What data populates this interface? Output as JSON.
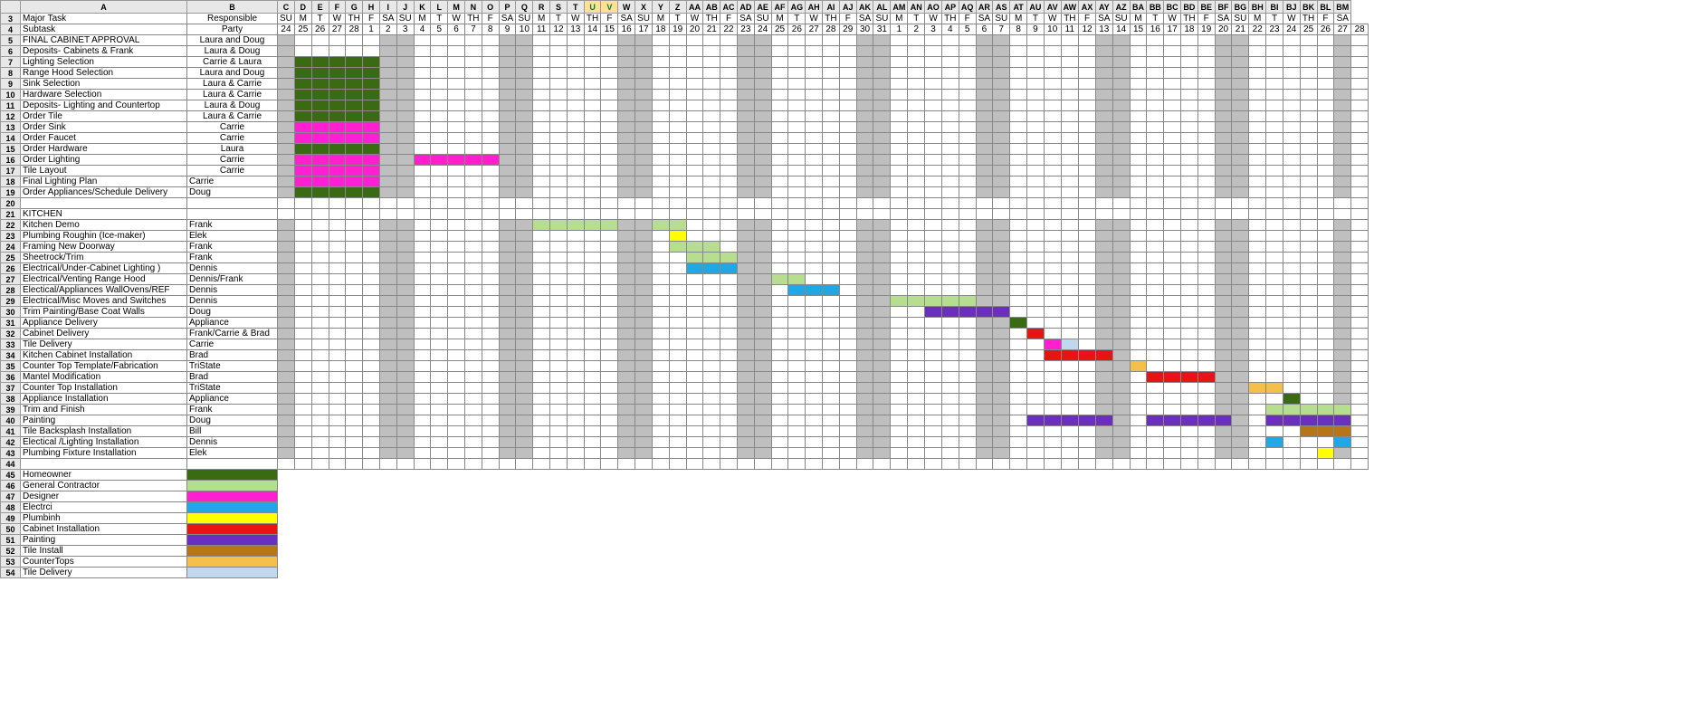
{
  "columns": [
    "A",
    "B",
    "C",
    "D",
    "E",
    "F",
    "G",
    "H",
    "I",
    "J",
    "K",
    "L",
    "M",
    "N",
    "O",
    "P",
    "Q",
    "R",
    "S",
    "T",
    "U",
    "V",
    "W",
    "X",
    "Y",
    "Z",
    "AA",
    "AB",
    "AC",
    "AD",
    "AE",
    "AF",
    "AG",
    "AH",
    "AI",
    "AJ",
    "AK",
    "AL",
    "AM",
    "AN",
    "AO",
    "AP",
    "AQ",
    "AR",
    "AS",
    "AT",
    "AU",
    "AV",
    "AW",
    "AX",
    "AY",
    "AZ",
    "BA",
    "BB",
    "BC",
    "BD",
    "BE",
    "BF",
    "BG",
    "BH",
    "BI",
    "BJ",
    "BK",
    "BL",
    "BM"
  ],
  "selected_cols": [
    "U",
    "V"
  ],
  "weekdays": [
    "SU",
    "M",
    "T",
    "W",
    "TH",
    "F",
    "SA",
    "SU",
    "M",
    "T",
    "W",
    "TH",
    "F",
    "SA",
    "SU",
    "M",
    "T",
    "W",
    "TH",
    "F",
    "SA",
    "SU",
    "M",
    "T",
    "W",
    "TH",
    "F",
    "SA",
    "SU",
    "M",
    "T",
    "W",
    "TH",
    "F",
    "SA",
    "SU",
    "M",
    "T",
    "W",
    "TH",
    "F",
    "SA",
    "SU",
    "M",
    "T",
    "W",
    "TH",
    "F",
    "SA",
    "SU",
    "M",
    "T",
    "W",
    "TH",
    "F",
    "SA",
    "SU",
    "M",
    "T",
    "W",
    "TH",
    "F",
    "SA"
  ],
  "dates": [
    "24",
    "25",
    "26",
    "27",
    "28",
    "1",
    "2",
    "3",
    "4",
    "5",
    "6",
    "7",
    "8",
    "9",
    "10",
    "11",
    "12",
    "13",
    "14",
    "15",
    "16",
    "17",
    "18",
    "19",
    "20",
    "21",
    "22",
    "23",
    "24",
    "25",
    "26",
    "27",
    "28",
    "29",
    "30",
    "31",
    "1",
    "2",
    "3",
    "4",
    "5",
    "6",
    "7",
    "8",
    "9",
    "10",
    "11",
    "12",
    "13",
    "14",
    "15",
    "16",
    "17",
    "18",
    "19",
    "20",
    "21",
    "22",
    "23",
    "24",
    "25",
    "26",
    "27",
    "28"
  ],
  "headers": {
    "major": "Major Task",
    "resp": "Responsible",
    "sub": "Subtask",
    "party": "Party"
  },
  "tasks": [
    {
      "r": 5,
      "a": "FINAL CABINET APPROVAL",
      "b": "Laura and Doug",
      "bc": "ac",
      "bars": []
    },
    {
      "r": 6,
      "a": "Deposits- Cabinets & Frank",
      "b": "Laura & Doug",
      "bc": "ac",
      "bars": []
    },
    {
      "r": 7,
      "a": "Lighting Selection",
      "b": "Carrie & Laura",
      "bc": "ac",
      "bars": [
        [
          1,
          5,
          "ho"
        ]
      ]
    },
    {
      "r": 8,
      "a": "Range Hood Selection",
      "b": "Laura and Doug",
      "bc": "ac",
      "bars": [
        [
          1,
          5,
          "ho"
        ]
      ]
    },
    {
      "r": 9,
      "a": "Sink Selection",
      "b": "Laura  & Carrie",
      "bc": "ac",
      "bars": [
        [
          1,
          5,
          "ho"
        ]
      ]
    },
    {
      "r": 10,
      "a": "Hardware Selection",
      "b": "Laura  & Carrie",
      "bc": "ac",
      "bars": [
        [
          1,
          5,
          "ho"
        ]
      ]
    },
    {
      "r": 11,
      "a": "Deposits- Lighting and Countertop",
      "b": "Laura & Doug",
      "bc": "ac",
      "bars": [
        [
          1,
          5,
          "ho"
        ]
      ]
    },
    {
      "r": 12,
      "a": "Order Tile",
      "b": "Laura & Carrie",
      "bc": "ac",
      "bars": [
        [
          1,
          5,
          "ho"
        ]
      ]
    },
    {
      "r": 13,
      "a": "Order Sink",
      "b": "Carrie",
      "bc": "ac",
      "bars": [
        [
          1,
          5,
          "dg"
        ]
      ]
    },
    {
      "r": 14,
      "a": "Order Faucet",
      "b": "Carrie",
      "bc": "ac",
      "bars": [
        [
          1,
          5,
          "dg"
        ]
      ]
    },
    {
      "r": 15,
      "a": "Order Hardware",
      "b": "Laura",
      "bc": "ac",
      "bars": [
        [
          1,
          5,
          "ho"
        ]
      ]
    },
    {
      "r": 16,
      "a": "Order Lighting",
      "b": "Carrie",
      "bc": "ac",
      "bars": [
        [
          1,
          5,
          "dg"
        ],
        [
          8,
          12,
          "dg"
        ]
      ]
    },
    {
      "r": 17,
      "a": "Tile Layout",
      "b": "Carrie",
      "bc": "ac",
      "bars": [
        [
          1,
          5,
          "dg"
        ]
      ]
    },
    {
      "r": 18,
      "a": "Final Lighting Plan",
      "b": "Carrie",
      "bc": "al",
      "bars": [
        [
          1,
          5,
          "dg"
        ]
      ]
    },
    {
      "r": 19,
      "a": "Order Appliances/Schedule Delivery",
      "b": "Doug",
      "bc": "al",
      "bars": [
        [
          1,
          5,
          "ho"
        ]
      ]
    },
    {
      "r": 20,
      "a": "",
      "b": "",
      "bars": []
    },
    {
      "r": 21,
      "a": "KITCHEN",
      "b": "",
      "bars": []
    },
    {
      "r": 22,
      "a": "Kitchen Demo",
      "b": "Frank",
      "bars": [
        [
          15,
          19,
          "gc"
        ],
        [
          22,
          23,
          "gc"
        ]
      ]
    },
    {
      "r": 23,
      "a": "Plumbing Roughin (Ice-maker)",
      "b": "Elek",
      "bars": [
        [
          23,
          23,
          "pl"
        ]
      ]
    },
    {
      "r": 24,
      "a": "Framing New Doorway",
      "b": "Frank",
      "bars": [
        [
          23,
          25,
          "gc"
        ]
      ]
    },
    {
      "r": 25,
      "a": "Sheetrock/Trim",
      "b": "Frank",
      "bars": [
        [
          24,
          26,
          "gc"
        ]
      ]
    },
    {
      "r": 26,
      "a": "Electrical/Under-Cabinet Lighting )",
      "b": "Dennis",
      "bars": [
        [
          24,
          26,
          "el"
        ]
      ]
    },
    {
      "r": 27,
      "a": "Electrical/Venting Range Hood",
      "b": "Dennis/Frank",
      "bars": [
        [
          29,
          30,
          "gc"
        ]
      ]
    },
    {
      "r": 28,
      "a": "Electical/Appliances WallOvens/REF",
      "b": "Dennis",
      "bars": [
        [
          30,
          32,
          "el"
        ]
      ]
    },
    {
      "r": 29,
      "a": "Electrical/Misc Moves and Switches",
      "b": "Dennis",
      "bars": [
        [
          36,
          40,
          "gc"
        ]
      ]
    },
    {
      "r": 30,
      "a": "Trim Painting/Base Coat Walls",
      "b": "Doug",
      "bars": [
        [
          38,
          42,
          "pt"
        ]
      ]
    },
    {
      "r": 31,
      "a": "Appliance Delivery",
      "b": "Appliance",
      "bars": [
        [
          43,
          43,
          "ho"
        ]
      ]
    },
    {
      "r": 32,
      "a": "Cabinet Delivery",
      "b": "Frank/Carrie & Brad",
      "bars": [
        [
          44,
          44,
          "ci"
        ]
      ]
    },
    {
      "r": 33,
      "a": "Tile Delivery",
      "b": "Carrie",
      "bars": [
        [
          45,
          45,
          "dg"
        ],
        [
          46,
          46,
          "td"
        ]
      ]
    },
    {
      "r": 34,
      "a": "Kitchen Cabinet Installation",
      "b": "Brad",
      "bars": [
        [
          45,
          48,
          "ci"
        ]
      ]
    },
    {
      "r": 35,
      "a": "Counter Top Template/Fabrication",
      "b": "TriState",
      "bars": [
        [
          50,
          50,
          "ct"
        ]
      ]
    },
    {
      "r": 36,
      "a": "Mantel Modification",
      "b": "Brad",
      "bars": [
        [
          51,
          54,
          "ci"
        ]
      ]
    },
    {
      "r": 37,
      "a": "Counter Top Installation",
      "b": "TriState",
      "bars": [
        [
          57,
          58,
          "ct"
        ]
      ]
    },
    {
      "r": 38,
      "a": "Appliance Installation",
      "b": "Appliance",
      "bars": [
        [
          59,
          59,
          "ho"
        ]
      ]
    },
    {
      "r": 39,
      "a": "Trim and Finish",
      "b": "Frank",
      "bars": [
        [
          58,
          62,
          "gc"
        ]
      ]
    },
    {
      "r": 40,
      "a": "Painting",
      "b": "Doug",
      "bars": [
        [
          44,
          48,
          "pt"
        ],
        [
          51,
          55,
          "pt"
        ],
        [
          58,
          62,
          "pt"
        ]
      ]
    },
    {
      "r": 41,
      "a": "Tile Backsplash Installation",
      "b": "Bill",
      "bars": [
        [
          60,
          62,
          "ti"
        ]
      ]
    },
    {
      "r": 42,
      "a": "Electical /Lighting Installation",
      "b": "Dennis",
      "bars": [
        [
          58,
          58,
          "el"
        ],
        [
          62,
          62,
          "el"
        ]
      ]
    },
    {
      "r": 43,
      "a": "Plumbing Fixture Installation",
      "b": "Elek",
      "bars": [
        [
          61,
          61,
          "pl"
        ]
      ]
    },
    {
      "r": 44,
      "a": "",
      "b": "",
      "bars": []
    }
  ],
  "legend": [
    {
      "r": 45,
      "label": "Homeowner",
      "color": "ho"
    },
    {
      "r": 46,
      "label": "General Contractor",
      "color": "gc"
    },
    {
      "r": 47,
      "label": "Designer",
      "color": "dg"
    },
    {
      "r": 48,
      "label": "Electrci",
      "color": "el"
    },
    {
      "r": 49,
      "label": "Plumbinh",
      "color": "pl"
    },
    {
      "r": 50,
      "label": "Cabinet Installation",
      "color": "ci"
    },
    {
      "r": 51,
      "label": "Painting",
      "color": "pt"
    },
    {
      "r": 52,
      "label": "Tile Install",
      "color": "ti"
    },
    {
      "r": 53,
      "label": "CounterTops",
      "color": "ct"
    },
    {
      "r": 54,
      "label": "Tile Delivery",
      "color": "td"
    }
  ],
  "colors": {
    "ho": "#3a6b12",
    "gc": "#b7dd8e",
    "dg": "#ff1fd1",
    "el": "#1fa8e8",
    "pl": "#ffff00",
    "ci": "#e61414",
    "pt": "#6b2fbf",
    "ti": "#b87418",
    "ct": "#f5c04a",
    "td": "#c1d7ee",
    "wk": "#bfbfbf"
  },
  "chart_data": {
    "type": "gantt",
    "title": "Kitchen Renovation Schedule (spreadsheet Gantt chart)",
    "x_axis": "calendar days (day number row 4, weekday row 3)",
    "series_meaning": "bar start/end are 0-based indices into the dates[] array above; color keys map to legend categories",
    "weekend_col_indices": [
      0,
      6,
      7,
      13,
      14,
      20,
      21,
      27,
      28,
      34,
      35,
      41,
      42,
      48,
      49,
      55,
      56,
      62
    ],
    "tasks": [
      {
        "name": "Lighting Selection",
        "party": "Carrie & Laura",
        "segments": [
          [
            1,
            5,
            "ho"
          ]
        ]
      },
      {
        "name": "Range Hood Selection",
        "party": "Laura and Doug",
        "segments": [
          [
            1,
            5,
            "ho"
          ]
        ]
      },
      {
        "name": "Sink Selection",
        "party": "Laura & Carrie",
        "segments": [
          [
            1,
            5,
            "ho"
          ]
        ]
      },
      {
        "name": "Hardware Selection",
        "party": "Laura & Carrie",
        "segments": [
          [
            1,
            5,
            "ho"
          ]
        ]
      },
      {
        "name": "Deposits- Lighting and Countertop",
        "party": "Laura & Doug",
        "segments": [
          [
            1,
            5,
            "ho"
          ]
        ]
      },
      {
        "name": "Order Tile",
        "party": "Laura & Carrie",
        "segments": [
          [
            1,
            5,
            "ho"
          ]
        ]
      },
      {
        "name": "Order Sink",
        "party": "Carrie",
        "segments": [
          [
            1,
            5,
            "dg"
          ]
        ]
      },
      {
        "name": "Order Faucet",
        "party": "Carrie",
        "segments": [
          [
            1,
            5,
            "dg"
          ]
        ]
      },
      {
        "name": "Order Hardware",
        "party": "Laura",
        "segments": [
          [
            1,
            5,
            "ho"
          ]
        ]
      },
      {
        "name": "Order Lighting",
        "party": "Carrie",
        "segments": [
          [
            1,
            5,
            "dg"
          ],
          [
            8,
            12,
            "dg"
          ]
        ]
      },
      {
        "name": "Tile Layout",
        "party": "Carrie",
        "segments": [
          [
            1,
            5,
            "dg"
          ]
        ]
      },
      {
        "name": "Final Lighting Plan",
        "party": "Carrie",
        "segments": [
          [
            1,
            5,
            "dg"
          ]
        ]
      },
      {
        "name": "Order Appliances/Schedule Delivery",
        "party": "Doug",
        "segments": [
          [
            1,
            5,
            "ho"
          ]
        ]
      },
      {
        "name": "Kitchen Demo",
        "party": "Frank",
        "segments": [
          [
            15,
            19,
            "gc"
          ],
          [
            22,
            23,
            "gc"
          ]
        ]
      },
      {
        "name": "Plumbing Roughin (Ice-maker)",
        "party": "Elek",
        "segments": [
          [
            23,
            23,
            "pl"
          ]
        ]
      },
      {
        "name": "Framing New Doorway",
        "party": "Frank",
        "segments": [
          [
            23,
            25,
            "gc"
          ]
        ]
      },
      {
        "name": "Sheetrock/Trim",
        "party": "Frank",
        "segments": [
          [
            24,
            26,
            "gc"
          ]
        ]
      },
      {
        "name": "Electrical/Under-Cabinet Lighting",
        "party": "Dennis",
        "segments": [
          [
            24,
            26,
            "el"
          ]
        ]
      },
      {
        "name": "Electrical/Venting Range Hood",
        "party": "Dennis/Frank",
        "segments": [
          [
            29,
            30,
            "gc"
          ]
        ]
      },
      {
        "name": "Electical/Appliances WallOvens/REF",
        "party": "Dennis",
        "segments": [
          [
            30,
            32,
            "el"
          ]
        ]
      },
      {
        "name": "Electrical/Misc Moves and Switches",
        "party": "Dennis",
        "segments": [
          [
            36,
            40,
            "gc"
          ]
        ]
      },
      {
        "name": "Trim Painting/Base Coat Walls",
        "party": "Doug",
        "segments": [
          [
            38,
            42,
            "pt"
          ]
        ]
      },
      {
        "name": "Appliance Delivery",
        "party": "Appliance",
        "segments": [
          [
            43,
            43,
            "ho"
          ]
        ]
      },
      {
        "name": "Cabinet Delivery",
        "party": "Frank/Carrie & Brad",
        "segments": [
          [
            44,
            44,
            "ci"
          ]
        ]
      },
      {
        "name": "Tile Delivery",
        "party": "Carrie",
        "segments": [
          [
            45,
            45,
            "dg"
          ],
          [
            46,
            46,
            "td"
          ]
        ]
      },
      {
        "name": "Kitchen Cabinet Installation",
        "party": "Brad",
        "segments": [
          [
            45,
            48,
            "ci"
          ]
        ]
      },
      {
        "name": "Counter Top Template/Fabrication",
        "party": "TriState",
        "segments": [
          [
            50,
            50,
            "ct"
          ]
        ]
      },
      {
        "name": "Mantel Modification",
        "party": "Brad",
        "segments": [
          [
            51,
            54,
            "ci"
          ]
        ]
      },
      {
        "name": "Counter Top Installation",
        "party": "TriState",
        "segments": [
          [
            57,
            58,
            "ct"
          ]
        ]
      },
      {
        "name": "Appliance Installation",
        "party": "Appliance",
        "segments": [
          [
            59,
            59,
            "ho"
          ]
        ]
      },
      {
        "name": "Trim and Finish",
        "party": "Frank",
        "segments": [
          [
            58,
            62,
            "gc"
          ]
        ]
      },
      {
        "name": "Painting",
        "party": "Doug",
        "segments": [
          [
            44,
            48,
            "pt"
          ],
          [
            51,
            55,
            "pt"
          ],
          [
            58,
            62,
            "pt"
          ]
        ]
      },
      {
        "name": "Tile Backsplash Installation",
        "party": "Bill",
        "segments": [
          [
            60,
            62,
            "ti"
          ]
        ]
      },
      {
        "name": "Electical /Lighting Installation",
        "party": "Dennis",
        "segments": [
          [
            58,
            58,
            "el"
          ],
          [
            62,
            62,
            "el"
          ]
        ]
      },
      {
        "name": "Plumbing Fixture Installation",
        "party": "Elek",
        "segments": [
          [
            61,
            61,
            "pl"
          ]
        ]
      }
    ],
    "legend": {
      "ho": "Homeowner",
      "gc": "General Contractor",
      "dg": "Designer",
      "el": "Electrician",
      "pl": "Plumbing",
      "ci": "Cabinet Installation",
      "pt": "Painting",
      "ti": "Tile Install",
      "ct": "CounterTops",
      "td": "Tile Delivery"
    }
  }
}
